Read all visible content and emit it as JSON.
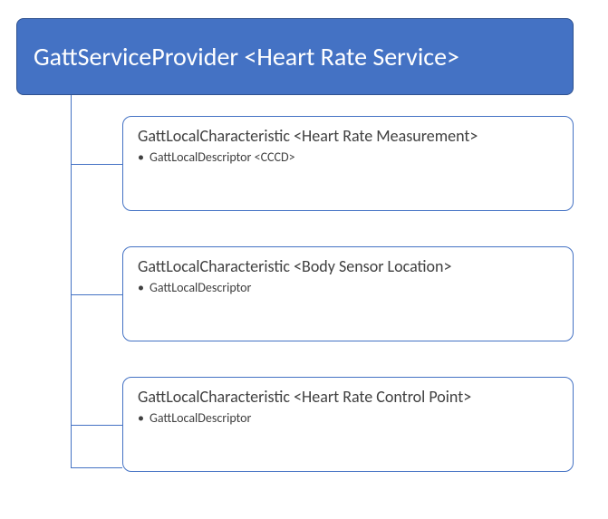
{
  "colors": {
    "accent": "#4472c4",
    "accent_border": "#2f528f",
    "text_dark": "#404040",
    "bg": "#ffffff"
  },
  "root": {
    "title": "GattServiceProvider <Heart Rate Service>"
  },
  "children": [
    {
      "title": "GattLocalCharacteristic <Heart Rate Measurement>",
      "descriptor": "GattLocalDescriptor <CCCD>"
    },
    {
      "title": "GattLocalCharacteristic <Body Sensor Location>",
      "descriptor": "GattLocalDescriptor"
    },
    {
      "title": "GattLocalCharacteristic <Heart Rate Control Point>",
      "descriptor": "GattLocalDescriptor"
    }
  ]
}
